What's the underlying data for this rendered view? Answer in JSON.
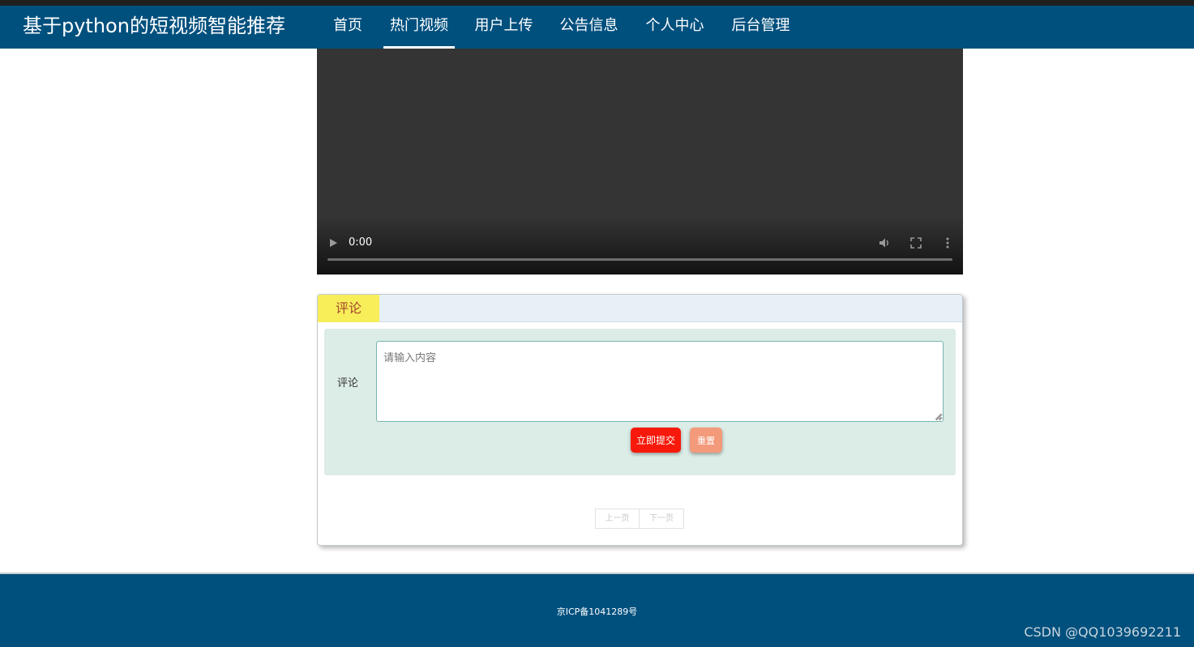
{
  "header": {
    "brand": "基于python的短视频智能推荐",
    "nav": [
      {
        "label": "首页",
        "active": false
      },
      {
        "label": "热门视频",
        "active": true
      },
      {
        "label": "用户上传",
        "active": false
      },
      {
        "label": "公告信息",
        "active": false
      },
      {
        "label": "个人中心",
        "active": false
      },
      {
        "label": "后台管理",
        "active": false
      }
    ]
  },
  "video": {
    "time": "0:00",
    "progress": 0,
    "icons": [
      "play-icon",
      "volume-icon",
      "fullscreen-icon",
      "more-vert-icon"
    ]
  },
  "comments": {
    "tab_label": "评论",
    "field_label": "评论",
    "input_placeholder": "请输入内容",
    "input_value": "",
    "submit_label": "立即提交",
    "reset_label": "重置",
    "prev_label": "上一页",
    "next_label": "下一页"
  },
  "footer": {
    "icp": "京ICP备1041289号",
    "watermark": "CSDN @QQ1039692211"
  },
  "colors": {
    "navbar": "#00507e",
    "tab": "#f8ee5a",
    "submit": "#f7190b",
    "reset": "#f39a7b",
    "form_bg": "#dcece6"
  }
}
